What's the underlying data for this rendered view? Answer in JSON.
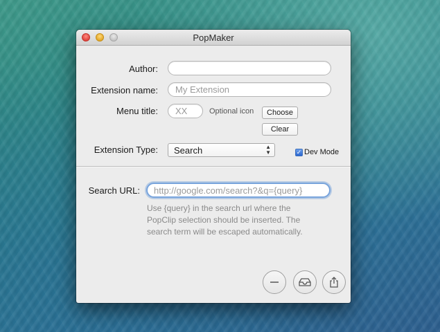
{
  "window": {
    "title": "PopMaker"
  },
  "form": {
    "author": {
      "label": "Author:",
      "value": "",
      "placeholder": ""
    },
    "extension_name": {
      "label": "Extension name:",
      "value": "",
      "placeholder": "My Extension"
    },
    "menu_title": {
      "label": "Menu title:",
      "value": "",
      "placeholder": "XX"
    },
    "optional_icon_label": "Optional icon",
    "choose_label": "Choose",
    "clear_label": "Clear",
    "extension_type": {
      "label": "Extension Type:",
      "selected": "Search"
    },
    "dev_mode": {
      "label": "Dev Mode",
      "checked": true
    }
  },
  "search": {
    "url_label": "Search URL:",
    "url_value": "",
    "url_placeholder": "http://google.com/search?&q={query}",
    "help_lines": [
      "Use {query} in the search url where the",
      "PopClip selection should be inserted. The",
      "search term will be escaped automatically."
    ]
  },
  "bottom_buttons": [
    {
      "name": "remove",
      "icon": "minus-icon"
    },
    {
      "name": "install",
      "icon": "tray-icon"
    },
    {
      "name": "share",
      "icon": "share-icon"
    }
  ],
  "colors": {
    "focus_ring": "#78a4dc",
    "checkbox_blue": "#2a66cf",
    "window_bg": "#ececec"
  }
}
